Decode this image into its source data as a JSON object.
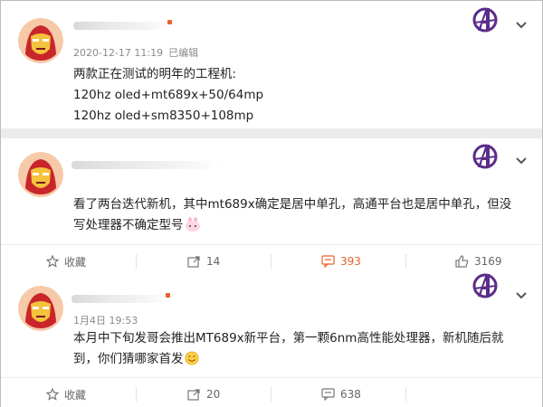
{
  "posts": [
    {
      "timestamp": "2020-12-17 11:19",
      "edited_label": "已编辑",
      "lines": [
        "两款正在测试的明年的工程机:",
        "120hz oled+mt689x+50/64mp",
        "120hz oled+sm8350+108mp"
      ]
    },
    {
      "lines": [
        "看了两台迭代新机，其中mt689x确定是居中单孔，高通平台也是居中单孔，但没",
        "写处理器不确定型号"
      ],
      "actions": {
        "favorite": "收藏",
        "repost": "14",
        "comment": "393",
        "like": "3169"
      }
    },
    {
      "timestamp": "1月4日 19:53",
      "lines": [
        "本月中下旬发哥会推出MT689x新平台，第一颗6nm高性能处理器，新机随后就",
        "到，你们猜哪家首发"
      ],
      "actions": {
        "favorite": "收藏",
        "repost": "20",
        "comment": "638"
      }
    }
  ],
  "icons": {
    "avatar": "iron-man-avatar-icon",
    "badge": "avengers-logo-icon",
    "menu": "chevron-down-icon",
    "favorite": "star-icon",
    "repost": "share-arrow-icon",
    "comment": "comment-icon",
    "like": "thumbs-up-icon",
    "emoji_bunny": "bunny-emoji-icon",
    "emoji_smile": "smile-emoji-icon"
  },
  "colors": {
    "accent": "#e8612a",
    "badge_purple": "#5b2c8a",
    "text": "#222222",
    "meta": "#8a8a8a"
  }
}
